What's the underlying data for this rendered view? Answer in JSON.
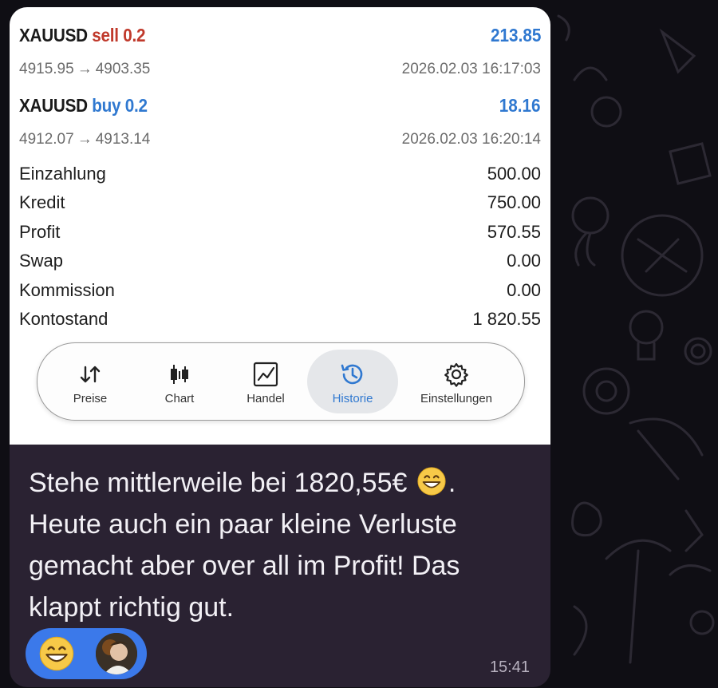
{
  "trades": [
    {
      "symbol": "XAUUSD",
      "side": "sell",
      "volume": "0.2",
      "profit": "213.85",
      "open_price": "4915.95",
      "close_price": "4903.35",
      "arrow": "→",
      "time": "2026.02.03 16:17:03"
    },
    {
      "symbol": "XAUUSD",
      "side": "buy",
      "volume": "0.2",
      "profit": "18.16",
      "open_price": "4912.07",
      "close_price": "4913.14",
      "arrow": "→",
      "time": "2026.02.03 16:20:14"
    }
  ],
  "summary": [
    {
      "label": "Einzahlung",
      "value": "500.00"
    },
    {
      "label": "Kredit",
      "value": "750.00"
    },
    {
      "label": "Profit",
      "value": "570.55"
    },
    {
      "label": "Swap",
      "value": "0.00"
    },
    {
      "label": "Kommission",
      "value": "0.00"
    },
    {
      "label": "Kontostand",
      "value": "1 820.55"
    }
  ],
  "tabs": [
    {
      "label": "Preise",
      "icon": "sort-arrows-icon"
    },
    {
      "label": "Chart",
      "icon": "candlestick-icon"
    },
    {
      "label": "Handel",
      "icon": "trade-chart-icon"
    },
    {
      "label": "Historie",
      "icon": "history-clock-icon",
      "active": true
    },
    {
      "label": "Einstellungen",
      "icon": "gear-icon"
    }
  ],
  "message": {
    "line1_before": "Stehe mittlerweile bei 1820,55€",
    "line1_after": ".",
    "line2": "Heute auch ein paar kleine Verluste",
    "line3": "gemacht aber over all im Profit! Das",
    "line4": "klappt richtig gut.",
    "emoji": "grinning-face-icon",
    "time": "15:41"
  },
  "reaction": {
    "emoji": "grinning-face-icon",
    "reactor": "avatar"
  },
  "colors": {
    "sell": "#c0392b",
    "buy": "#2f78d0",
    "profit": "#2f78d0",
    "reaction_bg": "#3b79ea",
    "bubble_bg": "#2a2232"
  }
}
